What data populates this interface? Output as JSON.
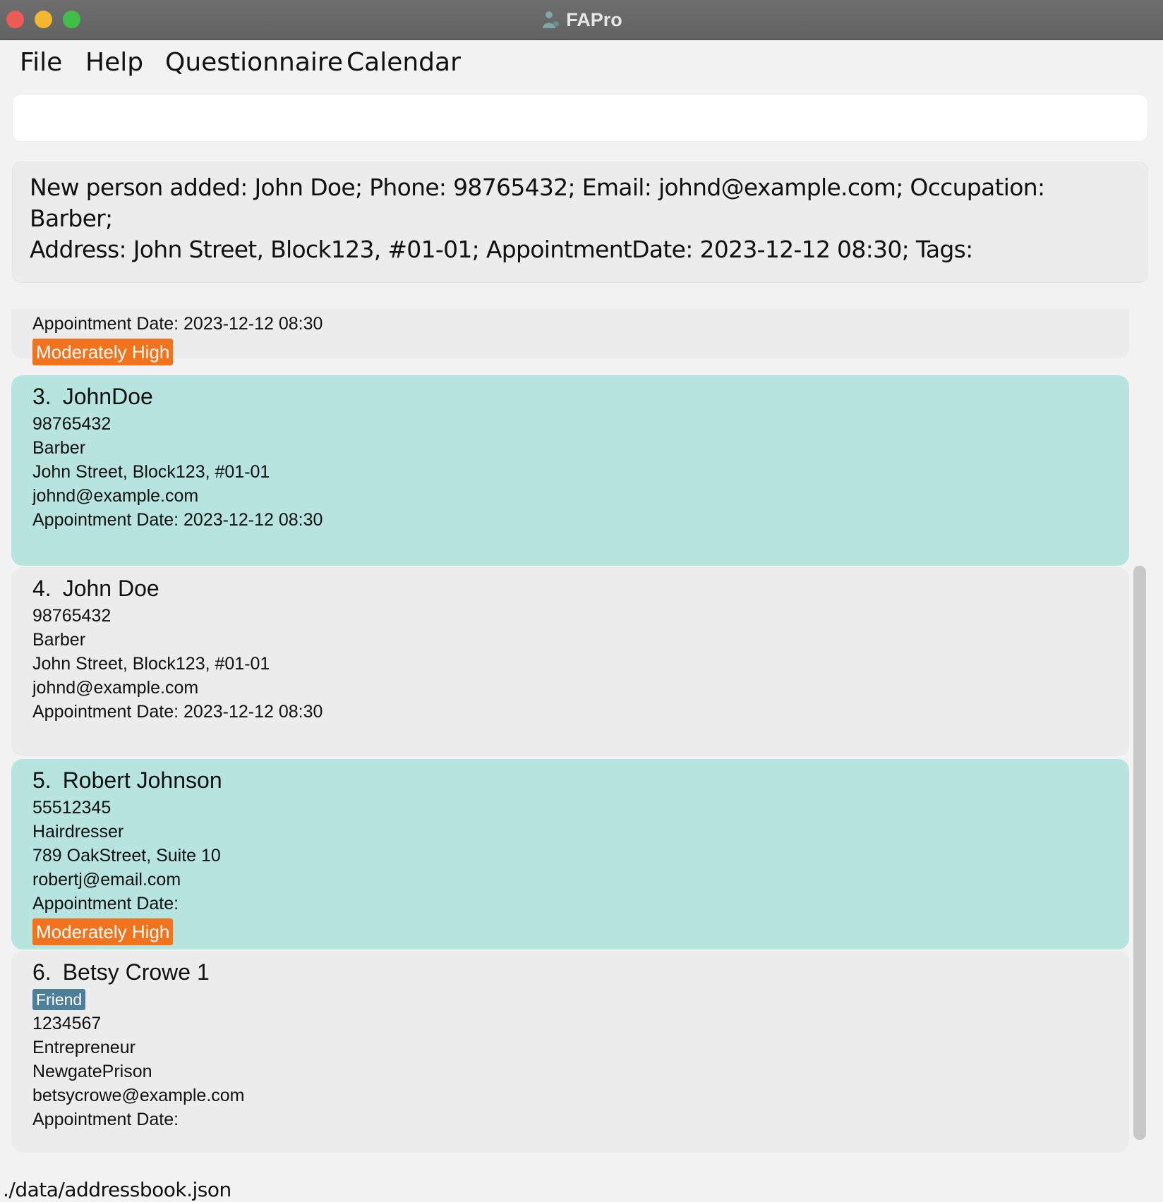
{
  "window": {
    "title": "FAPro"
  },
  "menu": {
    "file": "File",
    "help": "Help",
    "questionnaire": "Questionnaire",
    "calendar": "Calendar"
  },
  "command": {
    "value": "",
    "placeholder": ""
  },
  "result": {
    "line1": "New person added: John Doe; Phone: 98765432; Email: johnd@example.com; Occupation: Barber;",
    "line2": "Address: John Street, Block123, #01-01; AppointmentDate: 2023-12-12 08:30; Tags:"
  },
  "persons": {
    "p2": {
      "appointment": "Appointment Date: 2023-12-12 08:30",
      "tag": "Moderately High"
    },
    "p3": {
      "index": "3.",
      "name": "JohnDoe",
      "phone": "98765432",
      "occupation": "Barber",
      "address": "John Street, Block123, #01-01",
      "email": "johnd@example.com",
      "appointment": "Appointment Date: 2023-12-12 08:30"
    },
    "p4": {
      "index": "4.",
      "name": "John Doe",
      "phone": "98765432",
      "occupation": "Barber",
      "address": "John Street, Block123, #01-01",
      "email": "johnd@example.com",
      "appointment": "Appointment Date: 2023-12-12 08:30"
    },
    "p5": {
      "index": "5.",
      "name": "Robert Johnson",
      "phone": "55512345",
      "occupation": "Hairdresser",
      "address": "789 OakStreet, Suite 10",
      "email": "robertj@email.com",
      "appointment": "Appointment Date:",
      "tag": "Moderately High"
    },
    "p6": {
      "index": "6.",
      "name": "Betsy Crowe 1",
      "tag": "Friend",
      "phone": "1234567",
      "occupation": "Entrepreneur",
      "address": "NewgatePrison",
      "email": "betsycrowe@example.com",
      "appointment": "Appointment Date:"
    }
  },
  "status": {
    "path": "./data/addressbook.json"
  },
  "colors": {
    "card_highlight": "#b7e4de",
    "card_default": "#ececec",
    "tag_moderately_high": "#f2731e",
    "tag_friend": "#4e7f98"
  }
}
